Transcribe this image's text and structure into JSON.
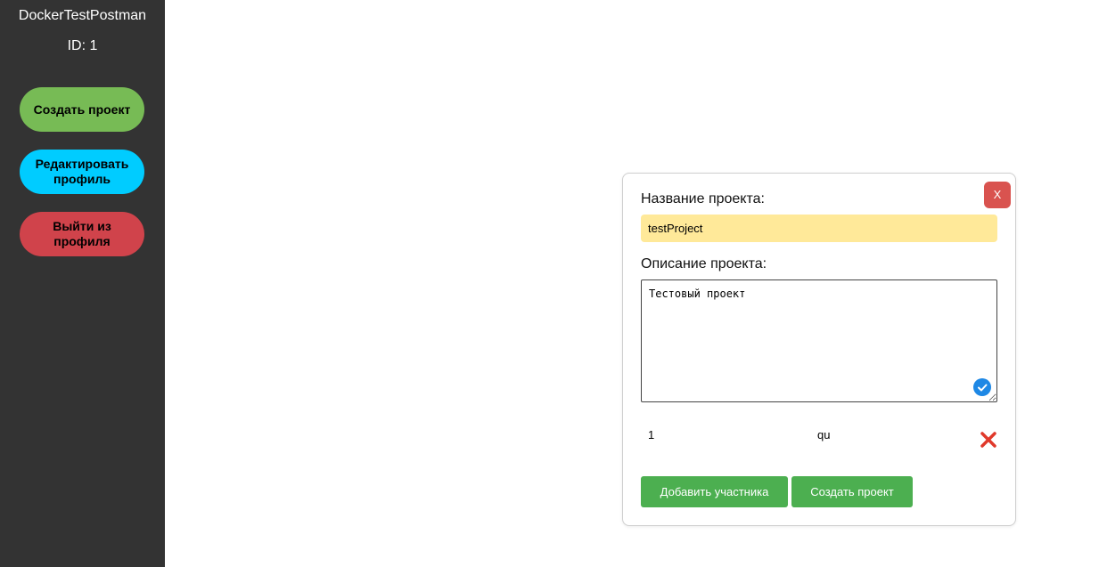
{
  "sidebar": {
    "username": "DockerTestPostman",
    "user_id": "ID: 1",
    "create_project": "Создать проект",
    "edit_profile": "Редактировать профиль",
    "logout": "Выйти из профиля"
  },
  "modal": {
    "close_label": "X",
    "name_label": "Название проекта:",
    "name_value": "testProject",
    "description_label": "Описание проекта:",
    "description_value": "Тестовый проект",
    "participants": [
      {
        "id": "1",
        "name": "qu"
      }
    ],
    "add_participant": "Добавить участника",
    "create_project": "Создать проект"
  },
  "colors": {
    "sidebar_bg": "#333333",
    "create_button": "#77bb55",
    "edit_button": "#00ccff",
    "logout_button": "#d0434b",
    "name_input_bg": "#ffe999",
    "close_button": "#d9534f",
    "action_button": "#4caf50"
  },
  "icons": {
    "close": "close-icon",
    "remove": "remove-participant-icon",
    "check": "check-icon"
  }
}
